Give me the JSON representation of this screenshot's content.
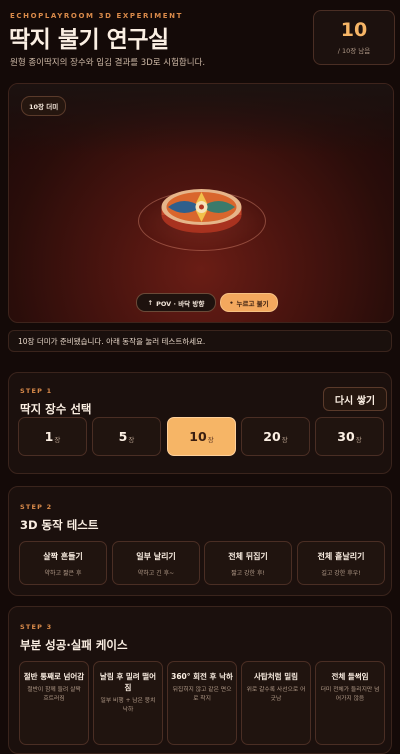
{
  "header": {
    "eyebrow": "ECHOPLAYROOM 3D EXPERIMENT",
    "title": "딱지 불기 연구실",
    "subtitle": "원형 종이딱지의 장수와 입김 결과를 3D로 시험합니다.",
    "counter": {
      "value": "10",
      "label": "/ 10장 남음"
    }
  },
  "stage": {
    "badge": "10장 더미",
    "pov_label": "POV · 바닥 방향",
    "press_label": "누르고 불기",
    "colors": {
      "accent": "#f6b566",
      "floor": "#5a1a12"
    }
  },
  "status_text": "10장 더미가 준비됐습니다. 아래 동작을 눌러 테스트하세요.",
  "step1": {
    "tag": "STEP 1",
    "title": "딱지 장수 선택",
    "restack_label": "다시 쌓기",
    "unit": "장",
    "options": [
      "1",
      "5",
      "10",
      "20",
      "30"
    ],
    "selected": "10"
  },
  "step2": {
    "tag": "STEP 2",
    "title": "3D 동작 테스트",
    "actions": [
      {
        "title": "살짝 흔들기",
        "sub": "약하고 짧은 후"
      },
      {
        "title": "일부 날리기",
        "sub": "약하고 긴 후~"
      },
      {
        "title": "전체 뒤집기",
        "sub": "짧고 강한 후!"
      },
      {
        "title": "전체 흩날리기",
        "sub": "길고 강한 후우!"
      }
    ]
  },
  "step3": {
    "tag": "STEP 3",
    "title": "부분 성공·실패 케이스",
    "cases": [
      {
        "title": "절반 통째로 넘어감",
        "sub": "절반이 함께 들려 살짝 흐트러짐"
      },
      {
        "title": "날림 후 밀려 떨어짐",
        "sub": "일부 비행 + 남은 뭉치 낙하"
      },
      {
        "title": "360° 회전 후 낙하",
        "sub": "뒤집히지 않고 같은 면으로 착지"
      },
      {
        "title": "사탑처럼 밀림",
        "sub": "위로 갈수록 사선으로 어긋남"
      },
      {
        "title": "전체 들썩임",
        "sub": "더미 전체가 들리지만 넘어가지 않음"
      }
    ]
  }
}
